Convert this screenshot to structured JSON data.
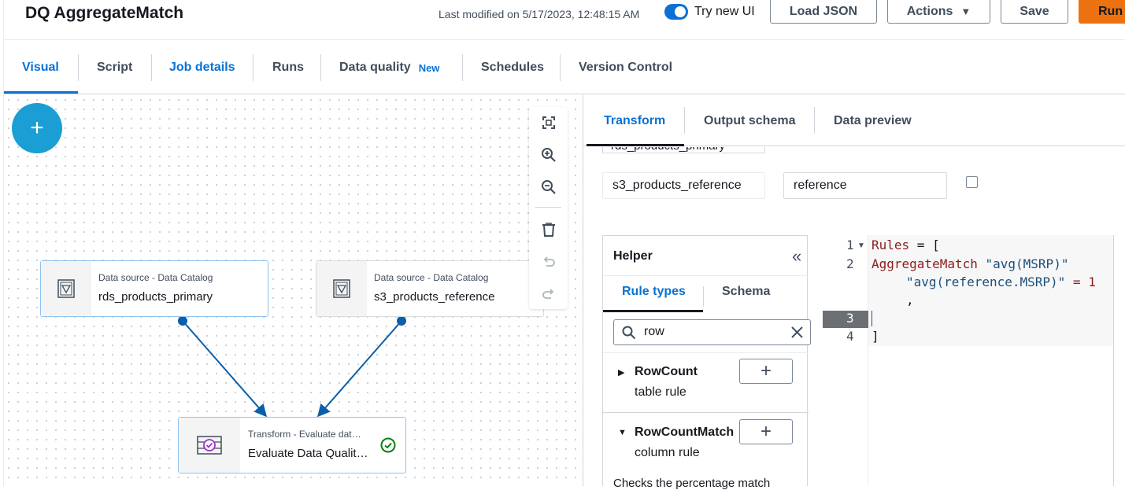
{
  "header": {
    "title": "DQ AggregateMatch",
    "last_modified": "Last modified on 5/17/2023, 12:48:15 AM",
    "try_new_ui": "Try new UI",
    "load_json": "Load JSON",
    "actions": "Actions",
    "save": "Save",
    "run": "Run"
  },
  "tabs": {
    "visual": "Visual",
    "script": "Script",
    "job_details": "Job details",
    "runs": "Runs",
    "data_quality": "Data quality",
    "new_badge": "New",
    "schedules": "Schedules",
    "version_control": "Version Control"
  },
  "canvas": {
    "nodes": [
      {
        "subtitle": "Data source - Data Catalog",
        "name": "rds_products_primary"
      },
      {
        "subtitle": "Data source - Data Catalog",
        "name": "s3_products_reference"
      },
      {
        "subtitle": "Transform - Evaluate dat…",
        "name": "Evaluate Data Qualit…"
      }
    ]
  },
  "panel": {
    "tabs": {
      "transform": "Transform",
      "output_schema": "Output schema",
      "data_preview": "Data preview"
    },
    "cut_field": "rds_products_primary",
    "source_field": "s3_products_reference",
    "alias_field": "reference"
  },
  "helper": {
    "title": "Helper",
    "tab_rule_types": "Rule types",
    "tab_schema": "Schema",
    "search_value": "row",
    "rules": [
      {
        "name": "RowCount",
        "type": "table rule",
        "expanded": false
      },
      {
        "name": "RowCountMatch",
        "type": "column rule",
        "expanded": true
      }
    ],
    "description": "Checks the percentage match"
  },
  "editor": {
    "line_numbers": [
      "1",
      "2",
      "3",
      "4"
    ],
    "line1_kw": "Rules",
    "line1_rest": " = [",
    "line2_kw": "AggregateMatch",
    "line2_str": " \"avg(MSRP)\"",
    "line2b_str": "\"avg(reference.MSRP)\"",
    "line2b_rest": " = 1",
    "line2c": ",",
    "line4": "]"
  },
  "colors": {
    "accent": "#0972d3",
    "run_button": "#ec7211",
    "add_button": "#1a9ed3",
    "success": "#037f0c"
  }
}
